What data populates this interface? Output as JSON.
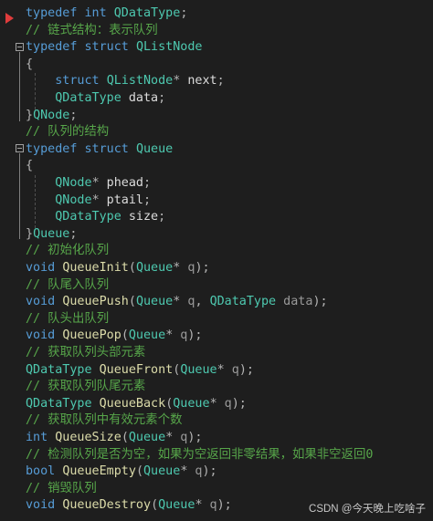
{
  "lines": [
    {
      "tokens": [
        [
          "kw",
          "typedef"
        ],
        [
          "id",
          " "
        ],
        [
          "kw",
          "int"
        ],
        [
          "id",
          " "
        ],
        [
          "ty",
          "QDataType"
        ],
        [
          "pn",
          ";"
        ]
      ]
    },
    {
      "tokens": [
        [
          "cm",
          "// 链式结构：表示队列"
        ]
      ]
    },
    {
      "tokens": [
        [
          "kw",
          "typedef"
        ],
        [
          "id",
          " "
        ],
        [
          "kw",
          "struct"
        ],
        [
          "id",
          " "
        ],
        [
          "ty",
          "QListNode"
        ]
      ]
    },
    {
      "tokens": [
        [
          "pn",
          "{"
        ]
      ]
    },
    {
      "tokens": [
        [
          "id",
          "    "
        ],
        [
          "kw",
          "struct"
        ],
        [
          "id",
          " "
        ],
        [
          "ty",
          "QListNode"
        ],
        [
          "pn",
          "*"
        ],
        [
          "id",
          " next"
        ],
        [
          "pn",
          ";"
        ]
      ]
    },
    {
      "tokens": [
        [
          "id",
          "    "
        ],
        [
          "ty",
          "QDataType"
        ],
        [
          "id",
          " data"
        ],
        [
          "pn",
          ";"
        ]
      ]
    },
    {
      "tokens": [
        [
          "pn",
          "}"
        ],
        [
          "ty",
          "QNode"
        ],
        [
          "pn",
          ";"
        ]
      ]
    },
    {
      "tokens": [
        [
          "cm",
          "// 队列的结构"
        ]
      ]
    },
    {
      "tokens": [
        [
          "kw",
          "typedef"
        ],
        [
          "id",
          " "
        ],
        [
          "kw",
          "struct"
        ],
        [
          "id",
          " "
        ],
        [
          "ty",
          "Queue"
        ]
      ]
    },
    {
      "tokens": [
        [
          "pn",
          "{"
        ]
      ]
    },
    {
      "tokens": [
        [
          "id",
          "    "
        ],
        [
          "ty",
          "QNode"
        ],
        [
          "pn",
          "*"
        ],
        [
          "id",
          " phead"
        ],
        [
          "pn",
          ";"
        ]
      ]
    },
    {
      "tokens": [
        [
          "id",
          "    "
        ],
        [
          "ty",
          "QNode"
        ],
        [
          "pn",
          "*"
        ],
        [
          "id",
          " ptail"
        ],
        [
          "pn",
          ";"
        ]
      ]
    },
    {
      "tokens": [
        [
          "id",
          "    "
        ],
        [
          "ty",
          "QDataType"
        ],
        [
          "id",
          " size"
        ],
        [
          "pn",
          ";"
        ]
      ]
    },
    {
      "tokens": [
        [
          "pn",
          "}"
        ],
        [
          "ty",
          "Queue"
        ],
        [
          "pn",
          ";"
        ]
      ]
    },
    {
      "tokens": [
        [
          "cm",
          "// 初始化队列"
        ]
      ]
    },
    {
      "tokens": [
        [
          "kw",
          "void"
        ],
        [
          "id",
          " "
        ],
        [
          "fn",
          "QueueInit"
        ],
        [
          "pn",
          "("
        ],
        [
          "ty",
          "Queue"
        ],
        [
          "pn",
          "*"
        ],
        [
          "pr",
          " q"
        ],
        [
          "pn",
          ");"
        ]
      ]
    },
    {
      "tokens": [
        [
          "cm",
          "// 队尾入队列"
        ]
      ]
    },
    {
      "tokens": [
        [
          "kw",
          "void"
        ],
        [
          "id",
          " "
        ],
        [
          "fn",
          "QueuePush"
        ],
        [
          "pn",
          "("
        ],
        [
          "ty",
          "Queue"
        ],
        [
          "pn",
          "*"
        ],
        [
          "pr",
          " q"
        ],
        [
          "pn",
          ", "
        ],
        [
          "ty",
          "QDataType"
        ],
        [
          "pr",
          " data"
        ],
        [
          "pn",
          ");"
        ]
      ]
    },
    {
      "tokens": [
        [
          "cm",
          "// 队头出队列"
        ]
      ]
    },
    {
      "tokens": [
        [
          "kw",
          "void"
        ],
        [
          "id",
          " "
        ],
        [
          "fn",
          "QueuePop"
        ],
        [
          "pn",
          "("
        ],
        [
          "ty",
          "Queue"
        ],
        [
          "pn",
          "*"
        ],
        [
          "pr",
          " q"
        ],
        [
          "pn",
          ");"
        ]
      ]
    },
    {
      "tokens": [
        [
          "cm",
          "// 获取队列头部元素"
        ]
      ]
    },
    {
      "tokens": [
        [
          "ty",
          "QDataType"
        ],
        [
          "id",
          " "
        ],
        [
          "fn",
          "QueueFront"
        ],
        [
          "pn",
          "("
        ],
        [
          "ty",
          "Queue"
        ],
        [
          "pn",
          "*"
        ],
        [
          "pr",
          " q"
        ],
        [
          "pn",
          ");"
        ]
      ]
    },
    {
      "tokens": [
        [
          "cm",
          "// 获取队列队尾元素"
        ]
      ]
    },
    {
      "tokens": [
        [
          "ty",
          "QDataType"
        ],
        [
          "id",
          " "
        ],
        [
          "fn",
          "QueueBack"
        ],
        [
          "pn",
          "("
        ],
        [
          "ty",
          "Queue"
        ],
        [
          "pn",
          "*"
        ],
        [
          "pr",
          " q"
        ],
        [
          "pn",
          ");"
        ]
      ]
    },
    {
      "tokens": [
        [
          "cm",
          "// 获取队列中有效元素个数"
        ]
      ]
    },
    {
      "tokens": [
        [
          "kw",
          "int"
        ],
        [
          "id",
          " "
        ],
        [
          "fn",
          "QueueSize"
        ],
        [
          "pn",
          "("
        ],
        [
          "ty",
          "Queue"
        ],
        [
          "pn",
          "*"
        ],
        [
          "pr",
          " q"
        ],
        [
          "pn",
          ");"
        ]
      ]
    },
    {
      "tokens": [
        [
          "cm",
          "// 检测队列是否为空，如果为空返回非零结果，如果非空返回0"
        ]
      ]
    },
    {
      "tokens": [
        [
          "kw",
          "bool"
        ],
        [
          "id",
          " "
        ],
        [
          "fn",
          "QueueEmpty"
        ],
        [
          "pn",
          "("
        ],
        [
          "ty",
          "Queue"
        ],
        [
          "pn",
          "*"
        ],
        [
          "pr",
          " q"
        ],
        [
          "pn",
          ");"
        ]
      ]
    },
    {
      "tokens": [
        [
          "cm",
          "// 销毁队列"
        ]
      ]
    },
    {
      "tokens": [
        [
          "kw",
          "void"
        ],
        [
          "id",
          " "
        ],
        [
          "fn",
          "QueueDestroy"
        ],
        [
          "pn",
          "("
        ],
        [
          "ty",
          "Queue"
        ],
        [
          "pn",
          "*"
        ],
        [
          "pr",
          " q"
        ],
        [
          "pn",
          ");"
        ]
      ]
    }
  ],
  "watermark": "CSDN @今天晚上吃啥子",
  "colors": {
    "background": "#1e1e1e",
    "keyword": "#569cd6",
    "type": "#4ec9b0",
    "function": "#dcdcaa",
    "comment": "#57a64a",
    "identifier": "#dcdcdc",
    "breakpoint_arrow": "#e03c3c"
  },
  "icons": [
    "execution-arrow-icon",
    "fold-collapse-icon"
  ]
}
